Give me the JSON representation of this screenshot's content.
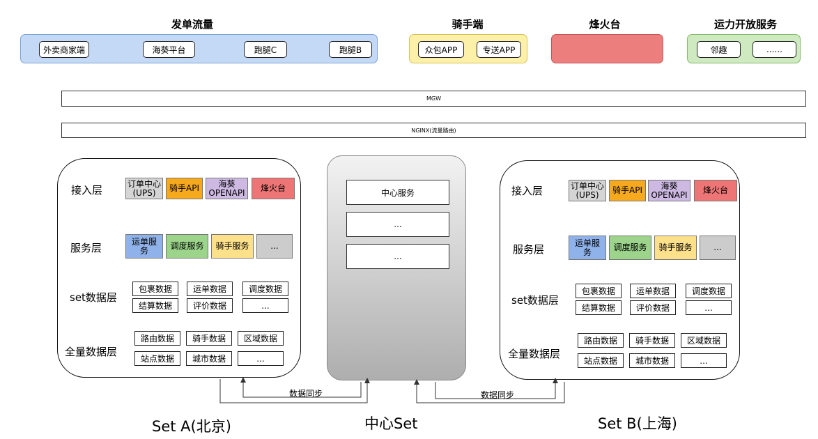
{
  "colors": {
    "blue": "#c4d9f5",
    "yellow": "#fdf0a8",
    "red": "#ec7e7e",
    "green": "#cfeac0",
    "chip_grey": "#d5d5d5",
    "chip_orange": "#f7a91e",
    "chip_purple": "#cdb9e2",
    "chip_red": "#ee7575",
    "chip_blue": "#8fb2ea",
    "chip_green": "#9bd48a",
    "chip_yellow": "#fde08a"
  },
  "top": {
    "order_traffic": {
      "title": "发单流量",
      "items": [
        "外卖商家端",
        "海葵平台",
        "跑腿C",
        "跑腿B"
      ]
    },
    "rider_end": {
      "title": "骑手端",
      "items": [
        "众包APP",
        "专送APP"
      ]
    },
    "beacon": {
      "title": "烽火台"
    },
    "capacity": {
      "title": "运力开放服务",
      "items": [
        "邻趣",
        "......"
      ]
    }
  },
  "bars": {
    "mgw": "MGW",
    "nginx": "NGINX(流量路由)"
  },
  "set_panel": {
    "access_layer": "接入层",
    "service_layer": "服务层",
    "set_data_layer": "set数据层",
    "full_data_layer": "全量数据层",
    "access_items": [
      "订单中心(UPS)",
      "骑手API",
      "海葵OPENAPI",
      "烽火台"
    ],
    "service_items": [
      "运单服务",
      "调度服务",
      "骑手服务",
      "..."
    ],
    "set_data_items": [
      "包裹数据",
      "运单数据",
      "调度数据",
      "结算数据",
      "评价数据",
      "..."
    ],
    "full_data_items": [
      "路由数据",
      "骑手数据",
      "区域数据",
      "站点数据",
      "城市数据",
      "..."
    ]
  },
  "center_set": {
    "items": [
      "中心服务",
      "...",
      "..."
    ]
  },
  "sync_label": "数据同步",
  "set_names": {
    "a": "Set A(北京)",
    "center": "中心Set",
    "b": "Set B(上海)"
  }
}
